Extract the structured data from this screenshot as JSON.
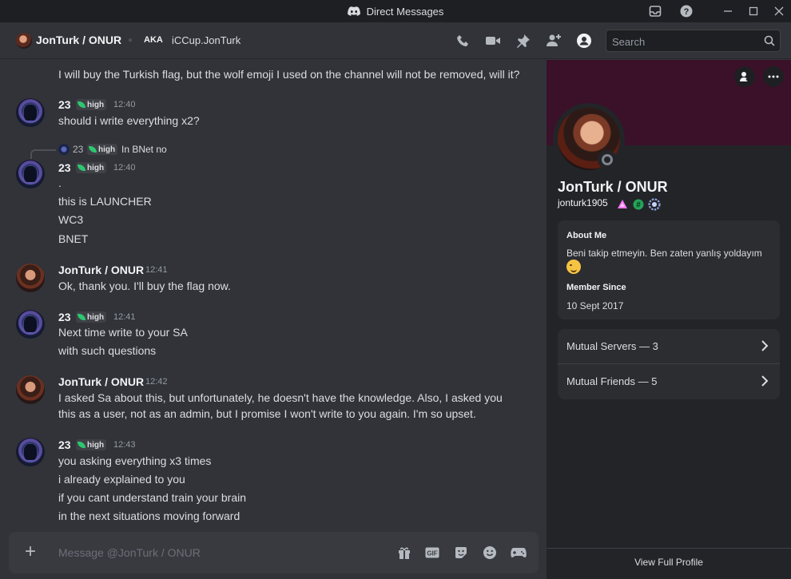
{
  "window": {
    "title": "Direct Messages"
  },
  "header": {
    "name": "JonTurk / ONUR",
    "aka_label": "AKA",
    "aka_name": "iCCup.JonTurk",
    "search_placeholder": "Search"
  },
  "messages": [
    {
      "text": "I will buy the Turkish flag, but the wolf emoji I used on the channel will not be removed, will it?"
    },
    {
      "author": "23",
      "badge": "high",
      "time": "12:40",
      "lines": [
        "should i write everything x2?"
      ]
    },
    {
      "reply": {
        "author": "23",
        "badge": "high",
        "text": "In BNet no"
      },
      "author": "23",
      "badge": "high",
      "time": "12:40",
      "lines": [
        ".",
        "this is LAUNCHER",
        "WC3",
        "BNET"
      ]
    },
    {
      "author": "JonTurk / ONUR",
      "time": "12:41",
      "lines": [
        "Ok, thank you. I'll buy the flag now."
      ]
    },
    {
      "author": "23",
      "badge": "high",
      "time": "12:41",
      "lines": [
        "Next time write to your SA",
        "with such questions"
      ]
    },
    {
      "author": "JonTurk / ONUR",
      "time": "12:42",
      "lines": [
        "I asked Sa about this, but unfortunately, he doesn't have the knowledge. Also, I asked you",
        "this as a user, not as an admin, but I promise I won't write to you again. I'm so upset."
      ]
    },
    {
      "author": "23",
      "badge": "high",
      "time": "12:43",
      "lines": [
        "you asking everything x3 times",
        "i already explained to you",
        "if you cant understand train your brain",
        "in the next situations moving forward"
      ]
    }
  ],
  "composer": {
    "placeholder": "Message @JonTurk / ONUR"
  },
  "profile": {
    "display_name": "JonTurk / ONUR",
    "username": "jonturk1905",
    "about_title": "About Me",
    "about_text": "Beni takip etmeyin. Ben zaten yanlış yoldayım",
    "member_since_title": "Member Since",
    "member_since": "10 Sept 2017",
    "mutual_servers": "Mutual Servers — 3",
    "mutual_friends": "Mutual Friends — 5",
    "view_full_profile": "View Full Profile"
  },
  "colors": {
    "banner": "#3b1129",
    "accent_green": "#2dc770"
  }
}
